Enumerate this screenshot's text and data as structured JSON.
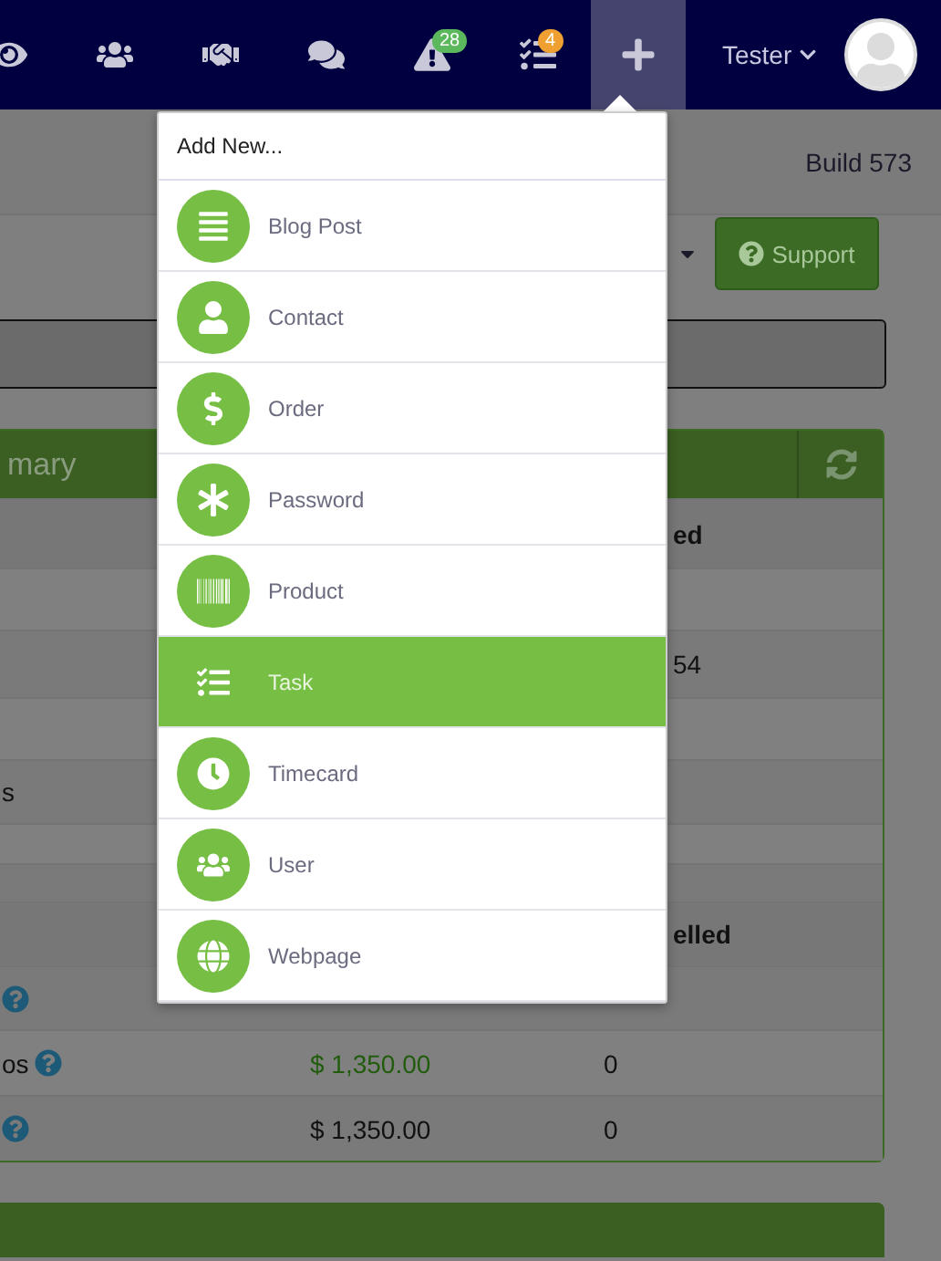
{
  "navbar": {
    "alerts_badge": "28",
    "tasks_badge": "4",
    "add_open": true,
    "user": "Tester"
  },
  "header": {
    "build": "Build 573"
  },
  "toolbar": {
    "support": "Support"
  },
  "summary_panel": {
    "title": "mary",
    "rows": [
      {
        "kind": "header",
        "column_4": "ed"
      },
      {
        "kind": "row"
      },
      {
        "kind": "row",
        "column_4": "54"
      },
      {
        "kind": "row"
      },
      {
        "kind": "row",
        "column_1": "s"
      },
      {
        "kind": "row"
      },
      {
        "kind": "row"
      },
      {
        "kind": "header",
        "column_4": "elled"
      },
      {
        "kind": "row",
        "help": true
      },
      {
        "kind": "row",
        "column_1": "os",
        "help": true,
        "column_2": "$ 1,350.00",
        "column_3": "0",
        "accent": true
      },
      {
        "kind": "row",
        "help": true,
        "column_2": "$ 1,350.00",
        "column_3": "0",
        "accent": false
      }
    ]
  },
  "add_menu": {
    "title": "Add New...",
    "items": [
      {
        "label": "Blog Post",
        "selected": false
      },
      {
        "label": "Contact",
        "selected": false
      },
      {
        "label": "Order",
        "selected": false
      },
      {
        "label": "Password",
        "selected": false
      },
      {
        "label": "Product",
        "selected": false
      },
      {
        "label": "Task",
        "selected": true
      },
      {
        "label": "Timecard",
        "selected": false
      },
      {
        "label": "User",
        "selected": false
      },
      {
        "label": "Webpage",
        "selected": false
      }
    ]
  }
}
